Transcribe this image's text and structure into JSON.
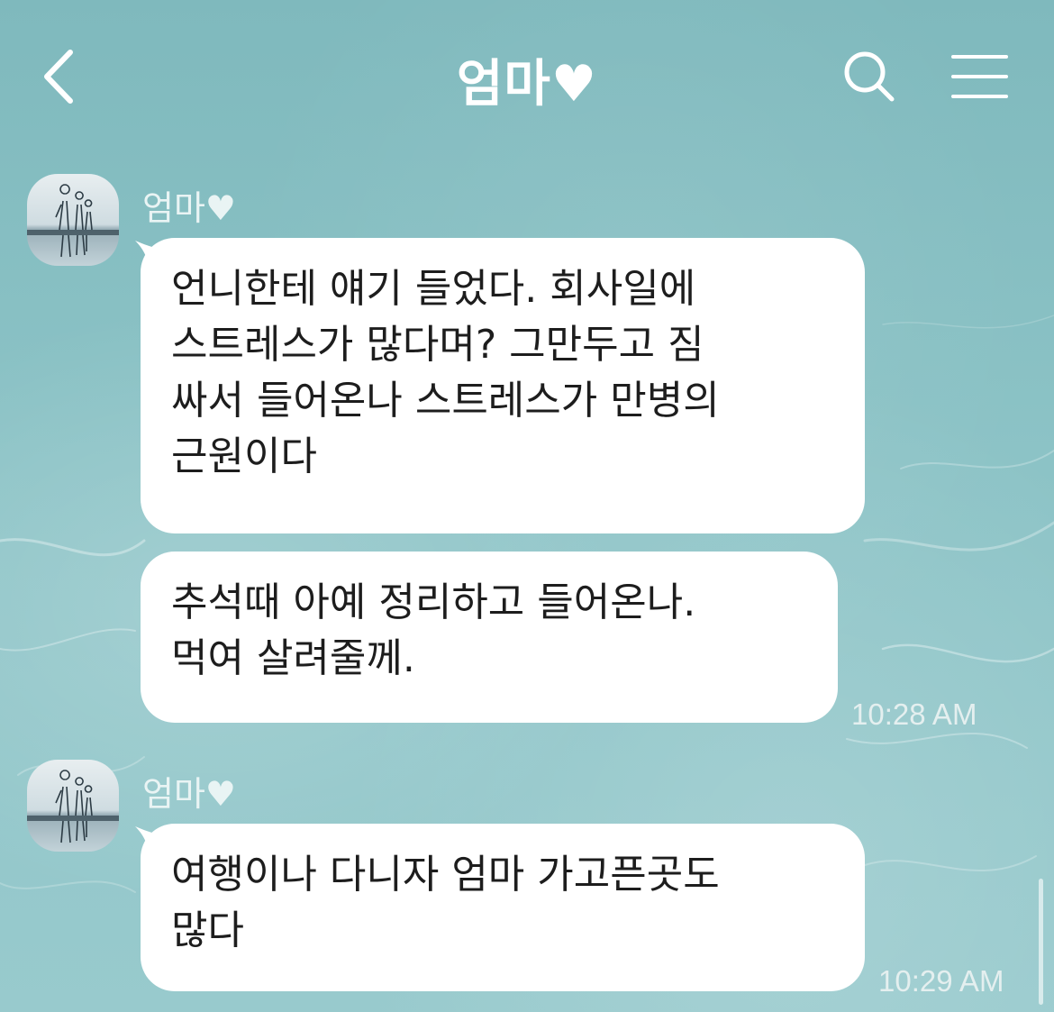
{
  "header": {
    "title": "엄마♥"
  },
  "messages": [
    {
      "sender": "엄마♥",
      "bubbles": [
        {
          "lines": [
            "언니한테 얘기 들었다. 회사일에",
            "스트레스가 많다며? 그만두고 짐",
            "싸서 들어온나 스트레스가 만병의",
            "근원이다"
          ]
        },
        {
          "lines": [
            "추석때 아예 정리하고 들어온나.",
            "먹여 살려줄께."
          ],
          "time": "10:28 AM"
        }
      ]
    },
    {
      "sender": "엄마♥",
      "bubbles": [
        {
          "lines": [
            "여행이나 다니자 엄마 가고픈곳도",
            "많다"
          ],
          "time": "10:29 AM"
        }
      ]
    }
  ]
}
